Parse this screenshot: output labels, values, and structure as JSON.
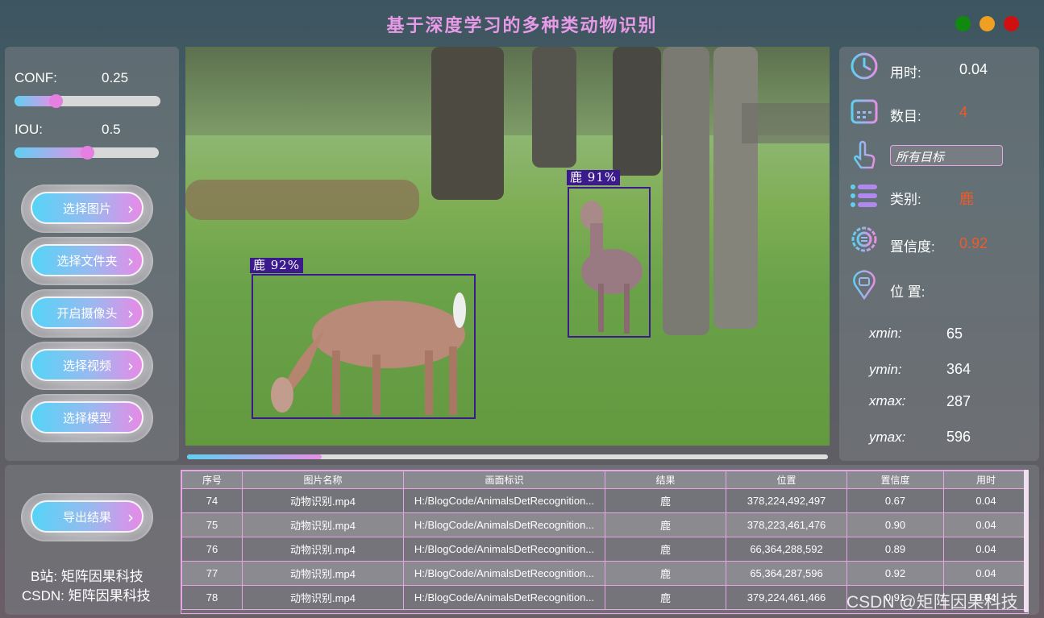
{
  "title": "基于深度学习的多种类动物识别",
  "window_buttons": {
    "green": "#0f8a0f",
    "yellow": "#f0a020",
    "red": "#d01010"
  },
  "params": {
    "conf_label": "CONF:",
    "conf_value": "0.25",
    "conf_fraction": 0.28,
    "iou_label": "IOU:",
    "iou_value": "0.5",
    "iou_fraction": 0.5
  },
  "buttons": {
    "select_image": "选择图片",
    "select_folder": "选择文件夹",
    "open_camera": "开启摄像头",
    "select_video": "选择视频",
    "select_model": "选择模型",
    "export": "导出结果",
    "chevron": "›"
  },
  "detections": [
    {
      "label": "鹿  92%"
    },
    {
      "label": "鹿  91%"
    }
  ],
  "video_progress_fraction": 0.21,
  "info": {
    "time_label": "用时:",
    "time_value": "0.04",
    "count_label": "数目:",
    "count_value": "4",
    "target_select": "所有目标",
    "class_label": "类别:",
    "class_value": "鹿",
    "conf_label": "置信度:",
    "conf_value": "0.92",
    "position_label": "位 置:",
    "value_color": "#f05a28",
    "xmin_label": "xmin:",
    "xmin": "65",
    "ymin_label": "ymin:",
    "ymin": "364",
    "xmax_label": "xmax:",
    "xmax": "287",
    "ymax_label": "ymax:",
    "ymax": "596"
  },
  "credits": {
    "bilibili": "B站: 矩阵因果科技",
    "csdn": "CSDN: 矩阵因果科技"
  },
  "table": {
    "headers": [
      "序号",
      "图片名称",
      "画面标识",
      "结果",
      "位置",
      "置信度",
      "用时"
    ],
    "rows": [
      [
        "74",
        "动物识别.mp4",
        "H:/BlogCode/AnimalsDetRecognition...",
        "鹿",
        "378,224,492,497",
        "0.67",
        "0.04"
      ],
      [
        "75",
        "动物识别.mp4",
        "H:/BlogCode/AnimalsDetRecognition...",
        "鹿",
        "378,223,461,476",
        "0.90",
        "0.04"
      ],
      [
        "76",
        "动物识别.mp4",
        "H:/BlogCode/AnimalsDetRecognition...",
        "鹿",
        "66,364,288,592",
        "0.89",
        "0.04"
      ],
      [
        "77",
        "动物识别.mp4",
        "H:/BlogCode/AnimalsDetRecognition...",
        "鹿",
        "65,364,287,596",
        "0.92",
        "0.04"
      ],
      [
        "78",
        "动物识别.mp4",
        "H:/BlogCode/AnimalsDetRecognition...",
        "鹿",
        "379,224,461,466",
        "0.91",
        "0.04"
      ]
    ]
  },
  "watermark": "CSDN @矩阵因果科技"
}
